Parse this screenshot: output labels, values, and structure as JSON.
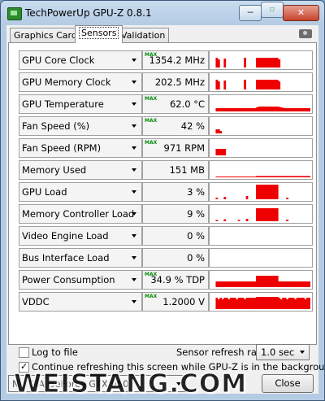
{
  "window": {
    "title": "TechPowerUp GPU-Z 0.8.1",
    "buttons": {
      "minimize": "─",
      "maximize": "□",
      "close": "✕"
    }
  },
  "tabs": [
    {
      "label": "Graphics Card",
      "active": false
    },
    {
      "label": "Sensors",
      "active": true
    },
    {
      "label": "Validation",
      "active": false
    }
  ],
  "sensors": [
    {
      "name": "GPU Core Clock",
      "value": "1354.2 MHz",
      "max_indicator": "MAX"
    },
    {
      "name": "GPU Memory Clock",
      "value": "202.5 MHz",
      "max_indicator": ""
    },
    {
      "name": "GPU Temperature",
      "value": "62.0 °C",
      "max_indicator": "MAX"
    },
    {
      "name": "Fan Speed (%)",
      "value": "42 %",
      "max_indicator": "MAX"
    },
    {
      "name": "Fan Speed (RPM)",
      "value": "971 RPM",
      "max_indicator": "MAX"
    },
    {
      "name": "Memory Used",
      "value": "151 MB",
      "max_indicator": ""
    },
    {
      "name": "GPU Load",
      "value": "3 %",
      "max_indicator": ""
    },
    {
      "name": "Memory Controller Load",
      "value": "9 %",
      "max_indicator": ""
    },
    {
      "name": "Video Engine Load",
      "value": "0 %",
      "max_indicator": ""
    },
    {
      "name": "Bus Interface Load",
      "value": "0 %",
      "max_indicator": ""
    },
    {
      "name": "Power Consumption",
      "value": "34.9 % TDP",
      "max_indicator": "MAX"
    },
    {
      "name": "VDDC",
      "value": "1.2000 V",
      "max_indicator": "MAX"
    }
  ],
  "graphs": [
    [
      0,
      0,
      0,
      60,
      50,
      0,
      0,
      55,
      0,
      0,
      0,
      0,
      0,
      0,
      0,
      0,
      0,
      60,
      0,
      0,
      0,
      0,
      0,
      60,
      60,
      60,
      60,
      60,
      60,
      60,
      60,
      60,
      60,
      60,
      50,
      0,
      0,
      0,
      0,
      0,
      0,
      0,
      0,
      0,
      0,
      0,
      0,
      0,
      0,
      0
    ],
    [
      0,
      0,
      0,
      60,
      50,
      0,
      0,
      55,
      0,
      0,
      0,
      0,
      0,
      0,
      0,
      0,
      0,
      60,
      0,
      0,
      0,
      0,
      0,
      60,
      60,
      60,
      60,
      60,
      60,
      60,
      60,
      60,
      60,
      60,
      50,
      0,
      0,
      0,
      0,
      0,
      0,
      0,
      0,
      0,
      0,
      0,
      0,
      0,
      0,
      0
    ],
    [
      0,
      0,
      0,
      20,
      20,
      20,
      20,
      20,
      20,
      20,
      20,
      20,
      20,
      20,
      20,
      20,
      20,
      20,
      20,
      20,
      20,
      20,
      20,
      25,
      30,
      30,
      30,
      30,
      30,
      30,
      30,
      30,
      30,
      30,
      28,
      25,
      22,
      20,
      20,
      20,
      20,
      20,
      20,
      20,
      20,
      20,
      20,
      20,
      20,
      20
    ],
    [
      0,
      0,
      0,
      25,
      25,
      15,
      0,
      0,
      0,
      0,
      0,
      0,
      0,
      0,
      0,
      0,
      0,
      0,
      0,
      0,
      0,
      0,
      0,
      0,
      0,
      0,
      0,
      0,
      0,
      0,
      0,
      0,
      0,
      0,
      0,
      0,
      0,
      0,
      0,
      0,
      0,
      0,
      0,
      0,
      0,
      0,
      0,
      0,
      0,
      0
    ],
    [
      0,
      0,
      0,
      40,
      40,
      40,
      40,
      40,
      0,
      0,
      0,
      0,
      0,
      0,
      0,
      0,
      0,
      0,
      0,
      0,
      0,
      0,
      0,
      0,
      0,
      0,
      0,
      0,
      0,
      0,
      0,
      0,
      0,
      0,
      0,
      0,
      0,
      0,
      0,
      0,
      0,
      0,
      0,
      0,
      0,
      0,
      0,
      0,
      0,
      0
    ],
    [
      0,
      0,
      0,
      5,
      5,
      5,
      5,
      5,
      5,
      5,
      5,
      5,
      5,
      5,
      5,
      5,
      5,
      5,
      5,
      5,
      5,
      5,
      5,
      8,
      8,
      8,
      8,
      8,
      8,
      8,
      8,
      8,
      8,
      8,
      8,
      8,
      8,
      8,
      8,
      8,
      8,
      8,
      8,
      8,
      8,
      8,
      8,
      8,
      8,
      8
    ],
    [
      0,
      0,
      0,
      10,
      0,
      0,
      0,
      15,
      0,
      0,
      0,
      0,
      0,
      0,
      0,
      0,
      0,
      0,
      20,
      0,
      0,
      0,
      0,
      90,
      90,
      90,
      90,
      90,
      90,
      90,
      90,
      90,
      90,
      90,
      0,
      0,
      0,
      0,
      10,
      0,
      0,
      0,
      0,
      0,
      0,
      0,
      0,
      0,
      0,
      0
    ],
    [
      0,
      0,
      0,
      8,
      0,
      0,
      0,
      12,
      0,
      0,
      0,
      0,
      0,
      0,
      8,
      0,
      0,
      0,
      15,
      0,
      0,
      0,
      0,
      80,
      80,
      80,
      80,
      80,
      80,
      80,
      80,
      80,
      80,
      80,
      0,
      0,
      0,
      0,
      10,
      0,
      0,
      0,
      0,
      0,
      0,
      0,
      0,
      0,
      0,
      0
    ],
    [
      0,
      0,
      0,
      0,
      0,
      0,
      0,
      0,
      0,
      0,
      0,
      0,
      0,
      0,
      0,
      0,
      0,
      0,
      0,
      0,
      0,
      0,
      0,
      0,
      0,
      0,
      0,
      0,
      0,
      0,
      0,
      0,
      0,
      0,
      0,
      0,
      0,
      0,
      0,
      0,
      0,
      0,
      0,
      0,
      0,
      0,
      0,
      0,
      0,
      0
    ],
    [
      0,
      0,
      0,
      0,
      0,
      0,
      0,
      0,
      0,
      0,
      0,
      0,
      0,
      0,
      0,
      0,
      0,
      0,
      0,
      0,
      0,
      0,
      0,
      0,
      0,
      0,
      0,
      0,
      0,
      0,
      0,
      0,
      0,
      0,
      0,
      0,
      0,
      0,
      0,
      0,
      0,
      0,
      0,
      0,
      0,
      0,
      0,
      0,
      0,
      0
    ],
    [
      0,
      0,
      0,
      35,
      35,
      35,
      35,
      35,
      35,
      35,
      35,
      35,
      35,
      35,
      35,
      35,
      35,
      35,
      35,
      35,
      35,
      35,
      35,
      70,
      70,
      70,
      70,
      70,
      70,
      70,
      70,
      70,
      70,
      70,
      35,
      35,
      35,
      35,
      35,
      35,
      35,
      35,
      35,
      35,
      35,
      35,
      35,
      35,
      35,
      35
    ],
    [
      0,
      0,
      0,
      70,
      60,
      70,
      60,
      70,
      70,
      60,
      70,
      70,
      70,
      60,
      70,
      70,
      70,
      60,
      70,
      70,
      70,
      70,
      70,
      75,
      75,
      75,
      75,
      75,
      75,
      75,
      75,
      75,
      75,
      75,
      70,
      60,
      70,
      70,
      60,
      70,
      70,
      70,
      60,
      70,
      70,
      70,
      70,
      60,
      70,
      70
    ]
  ],
  "options": {
    "log_to_file_label": "Log to file",
    "log_to_file_checked": false,
    "refresh_rate_label": "Sensor refresh rate:",
    "refresh_rate_value": "1.0 sec",
    "continue_refresh_label": "Continue refreshing this screen while GPU-Z is in the background",
    "continue_refresh_checked": true
  },
  "gpu_selector": {
    "value": "NVIDIA GeForce GTX 960"
  },
  "close_button": {
    "label": "Close"
  },
  "watermark": {
    "text": "WEISTANG.COM"
  },
  "colors": {
    "graph": "#ee0000",
    "max_text": "#0a8a0a"
  }
}
